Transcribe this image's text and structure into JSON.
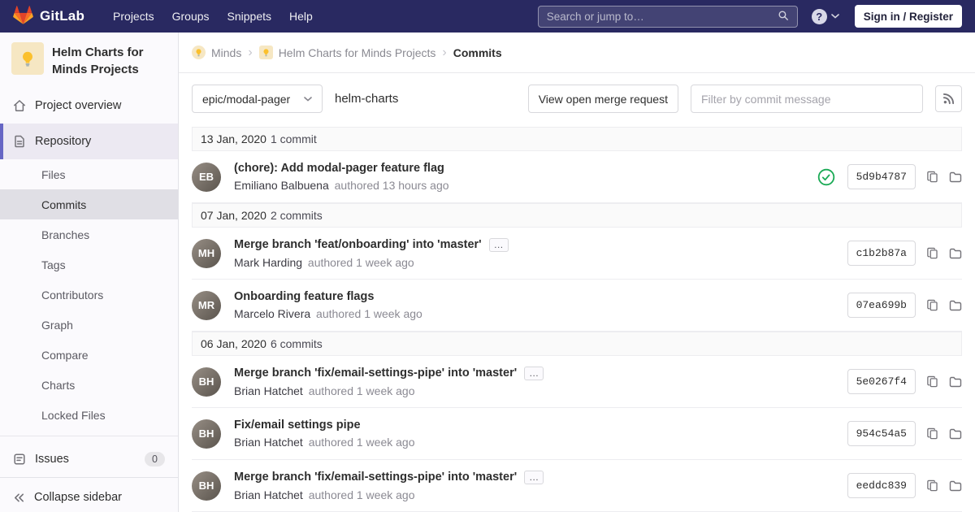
{
  "navbar": {
    "brand": "GitLab",
    "links": [
      {
        "label": "Projects"
      },
      {
        "label": "Groups"
      },
      {
        "label": "Snippets"
      },
      {
        "label": "Help"
      }
    ],
    "search_placeholder": "Search or jump to…",
    "help_label": "?",
    "sign_in_label": "Sign in / Register"
  },
  "sidebar": {
    "project_title": "Helm Charts for Minds Projects",
    "overview_label": "Project overview",
    "repository_label": "Repository",
    "repo_items": [
      {
        "label": "Files"
      },
      {
        "label": "Commits"
      },
      {
        "label": "Branches"
      },
      {
        "label": "Tags"
      },
      {
        "label": "Contributors"
      },
      {
        "label": "Graph"
      },
      {
        "label": "Compare"
      },
      {
        "label": "Charts"
      },
      {
        "label": "Locked Files"
      }
    ],
    "issues_label": "Issues",
    "issues_count": "0",
    "collapse_label": "Collapse sidebar"
  },
  "breadcrumb": {
    "group": "Minds",
    "project": "Helm Charts for Minds Projects",
    "current": "Commits"
  },
  "controls": {
    "branch": "epic/modal-pager",
    "repo_path": "helm-charts",
    "mr_button": "View open merge request",
    "filter_placeholder": "Filter by commit message"
  },
  "commit_ui": {
    "ellipsis": "…"
  },
  "groups": [
    {
      "date": "13 Jan, 2020",
      "count": "1 commit",
      "commits": [
        {
          "title": "(chore): Add modal-pager feature flag",
          "author": "Emiliano Balbuena",
          "time": "authored 13 hours ago",
          "sha": "5d9b4787",
          "initials": "EB"
        }
      ]
    },
    {
      "date": "07 Jan, 2020",
      "count": "2 commits",
      "commits": [
        {
          "title": "Merge branch 'feat/onboarding' into 'master'",
          "author": "Mark Harding",
          "time": "authored 1 week ago",
          "sha": "c1b2b87a",
          "initials": "MH"
        },
        {
          "title": "Onboarding feature flags",
          "author": "Marcelo Rivera",
          "time": "authored 1 week ago",
          "sha": "07ea699b",
          "initials": "MR"
        }
      ]
    },
    {
      "date": "06 Jan, 2020",
      "count": "6 commits",
      "commits": [
        {
          "title": "Merge branch 'fix/email-settings-pipe' into 'master'",
          "author": "Brian Hatchet",
          "time": "authored 1 week ago",
          "sha": "5e0267f4",
          "initials": "BH"
        },
        {
          "title": "Fix/email settings pipe",
          "author": "Brian Hatchet",
          "time": "authored 1 week ago",
          "sha": "954c54a5",
          "initials": "BH"
        },
        {
          "title": "Merge branch 'fix/email-settings-pipe' into 'master'",
          "author": "Brian Hatchet",
          "time": "authored 1 week ago",
          "sha": "eeddc839",
          "initials": "BH"
        }
      ]
    }
  ],
  "colors": {
    "navbar_bg": "#292961",
    "accent_purple": "#6666c4",
    "success_green": "#1aaa55",
    "brand_orange": "#e24329",
    "avatar_yellow": "#f6e7c3"
  },
  "icons": {
    "gitlab-logo": "tanuki",
    "search": "magnifier",
    "help": "question-circle",
    "chevron-down": "▾",
    "home": "house outline",
    "repository": "document outline",
    "issues": "task-list outline",
    "collapse": "double-chevron-left",
    "lightbulb": "project avatar bulb",
    "rss": "feed",
    "pipeline-passed": "green check circle",
    "copy-sha": "clipboard",
    "browse-files": "folder"
  }
}
